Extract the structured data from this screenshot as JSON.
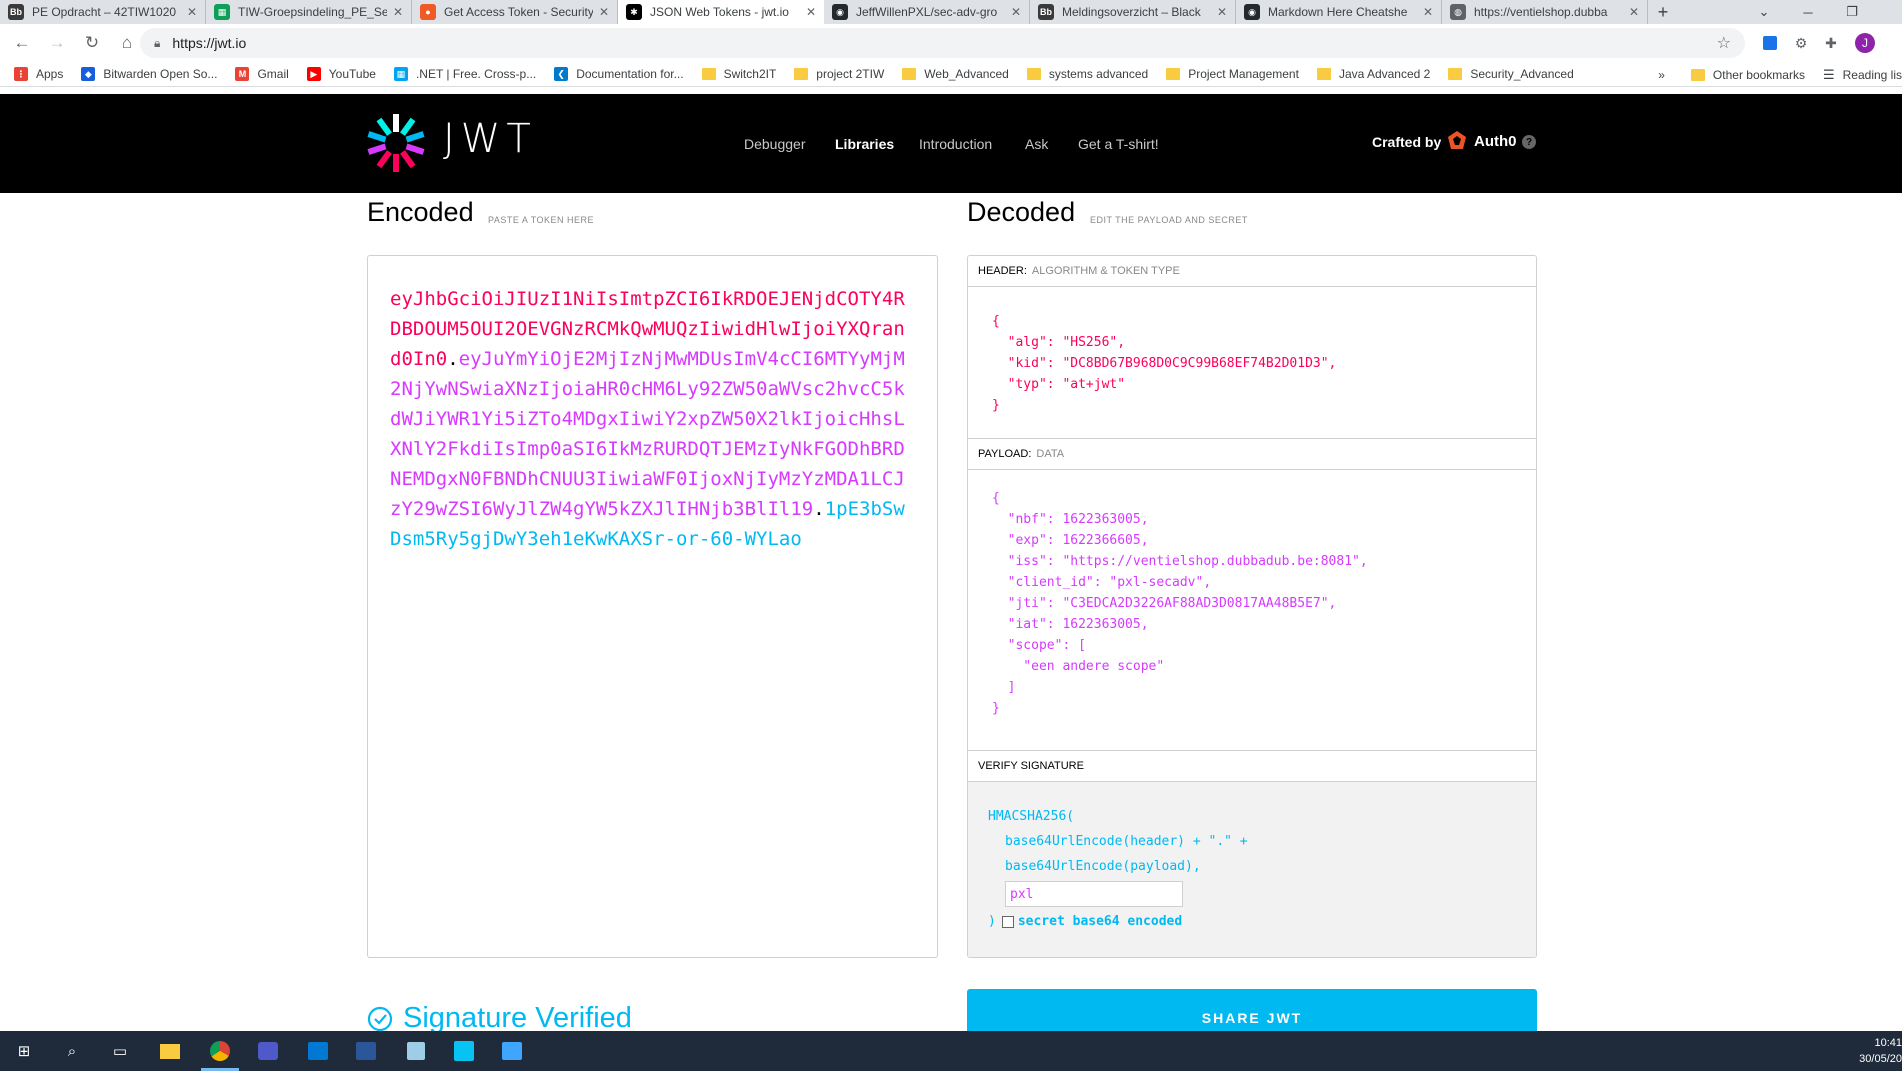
{
  "browser": {
    "tabs": [
      {
        "title": "PE Opdracht – 42TIW1020",
        "icon": "blackboard-icon",
        "color": "#3a3a3a",
        "glyph": "Bb"
      },
      {
        "title": "TIW-Groepsindeling_PE_Se",
        "icon": "sheets-icon",
        "color": "#0f9d58",
        "glyph": "▦"
      },
      {
        "title": "Get Access Token - Security",
        "icon": "postman-icon",
        "color": "#ef5b25",
        "glyph": "●"
      },
      {
        "title": "JSON Web Tokens - jwt.io",
        "icon": "jwt-icon",
        "color": "#000000",
        "glyph": "✱"
      },
      {
        "title": "JeffWillenPXL/sec-adv-gro",
        "icon": "github-icon",
        "color": "#24292e",
        "glyph": "◉"
      },
      {
        "title": "Meldingsoverzicht – Black",
        "icon": "blackboard-icon",
        "color": "#3a3a3a",
        "glyph": "Bb"
      },
      {
        "title": "Markdown Here Cheatshe",
        "icon": "github-icon",
        "color": "#24292e",
        "glyph": "◉"
      },
      {
        "title": "https://ventielshop.dubba",
        "icon": "globe-icon",
        "color": "#5f6368",
        "glyph": "◍"
      }
    ],
    "url": "https://jwt.io",
    "bookmarks": [
      {
        "label": "Apps",
        "type": "apps"
      },
      {
        "label": "Bitwarden Open So...",
        "type": "shield"
      },
      {
        "label": "Gmail",
        "type": "gmail"
      },
      {
        "label": "YouTube",
        "type": "youtube"
      },
      {
        "label": ".NET | Free. Cross-p...",
        "type": "ms"
      },
      {
        "label": "Documentation for...",
        "type": "vscode"
      },
      {
        "label": "Switch2IT",
        "type": "folder"
      },
      {
        "label": "project 2TIW",
        "type": "folder"
      },
      {
        "label": "Web_Advanced",
        "type": "folder"
      },
      {
        "label": "systems advanced",
        "type": "folder"
      },
      {
        "label": "Project Management",
        "type": "folder"
      },
      {
        "label": "Java Advanced 2",
        "type": "folder"
      },
      {
        "label": "Security_Advanced",
        "type": "folder"
      }
    ],
    "bookmarks_more": "»",
    "other_bookmarks": "Other bookmarks",
    "reading_list": "Reading lis",
    "avatar_letter": "J"
  },
  "jwt": {
    "logo_text": "JWT",
    "nav": [
      "Debugger",
      "Libraries",
      "Introduction",
      "Ask",
      "Get a T-shirt!"
    ],
    "active_nav": "Libraries",
    "crafted_by": "Crafted by",
    "auth0": "Auth0",
    "help": "?",
    "encoded_title": "Encoded",
    "encoded_sub": "PASTE A TOKEN HERE",
    "decoded_title": "Decoded",
    "decoded_sub": "EDIT THE PAYLOAD AND SECRET",
    "token_header": "eyJhbGciOiJIUzI1NiIsImtpZCI6IkRDOEJENjdCOTY4RDBDOUM5OUI2OEVGNzRCMkQwMUQzIiwidHlwIjoiYXQrand0In0",
    "token_payload": "eyJuYmYiOjE2MjIzNjMwMDUsImV4cCI6MTYyMjM2NjYwNSwiaXNzIjoiaHR0cHM6Ly92ZW50aWVsc2hvcC5kdWJiYWR1Yi5iZTo4MDgxIiwiY2xpZW50X2lkIjoicHhsLXNlY2FkdiIsImp0aSI6IkMzRURDQTJEMzIyNkFGODhBRDNEMDgxN0FBNDhCNUU3IiwiaWF0IjoxNjIyMzYzMDA1LCJzY29wZSI6WyJlZW4gYW5kZXJlIHNjb3BlIl19",
    "token_signature": "1pE3bSwDsm5Ry5gjDwY3eh1eKwKAXSr-or-60-WYLao",
    "dot": ".",
    "header_label": "HEADER:",
    "header_sub": "ALGORITHM & TOKEN TYPE",
    "header_json": "{\n  \"alg\": \"HS256\",\n  \"kid\": \"DC8BD67B968D0C9C99B68EF74B2D01D3\",\n  \"typ\": \"at+jwt\"\n}",
    "payload_label": "PAYLOAD:",
    "payload_sub": "DATA",
    "payload_json": "{\n  \"nbf\": 1622363005,\n  \"exp\": 1622366605,\n  \"iss\": \"https://ventielshop.dubbadub.be:8081\",\n  \"client_id\": \"pxl-secadv\",\n  \"jti\": \"C3EDCA2D3226AF88AD3D0817AA48B5E7\",\n  \"iat\": 1622363005,\n  \"scope\": [\n    \"een andere scope\"\n  ]\n}",
    "verify_label": "VERIFY SIGNATURE",
    "sig_fn": "HMACSHA256(",
    "sig_line1": "base64UrlEncode(header) + \".\" +",
    "sig_line2": "base64UrlEncode(payload),",
    "secret_value": "pxl",
    "sig_close": ")",
    "secret_b64_label": "secret base64 encoded",
    "verified_text": "Signature Verified",
    "share_label": "SHARE JWT"
  },
  "taskbar": {
    "time": "10:41",
    "date": "30/05/20"
  },
  "colors": {
    "header_red": "#fb015b",
    "payload_purple": "#d63aff",
    "signature_blue": "#00b9f1"
  }
}
